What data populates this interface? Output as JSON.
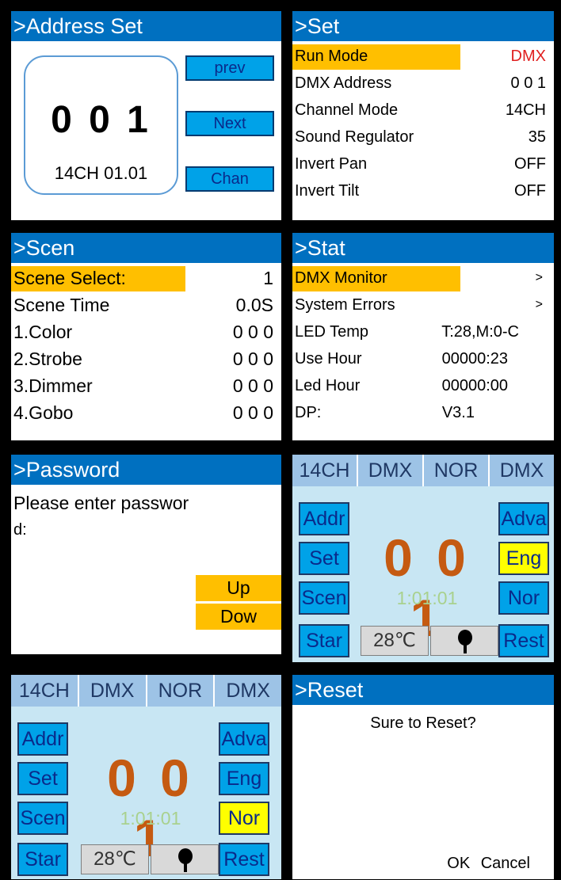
{
  "address_set": {
    "title": ">Address Set",
    "value": "0 0 1",
    "subtitle": "14CH 01.01",
    "buttons": {
      "prev": "prev",
      "next": "Next",
      "chan": "Chan"
    }
  },
  "set": {
    "title": ">Set",
    "rows": [
      {
        "label": "Run Mode",
        "value": "DMX"
      },
      {
        "label": "DMX Address",
        "value": "0 0 1"
      },
      {
        "label": "Channel Mode",
        "value": "14CH"
      },
      {
        "label": "Sound Regulator",
        "value": "35"
      },
      {
        "label": "Invert Pan",
        "value": "OFF"
      },
      {
        "label": "Invert Tilt",
        "value": "OFF"
      }
    ],
    "highlight_color": "#ffbf00",
    "accent_value_color": "#e02020"
  },
  "scen": {
    "title": ">Scen",
    "rows": [
      {
        "label": "Scene Select:",
        "value": "1"
      },
      {
        "label": "Scene Time",
        "value": "0.0S"
      },
      {
        "label": "1.Color",
        "value": "0 0 0"
      },
      {
        "label": "2.Strobe",
        "value": "0 0 0"
      },
      {
        "label": "3.Dimmer",
        "value": "0 0 0"
      },
      {
        "label": "4.Gobo",
        "value": "0 0 0"
      }
    ]
  },
  "stat": {
    "title": ">Stat",
    "rows": [
      {
        "label": "DMX Monitor",
        "value": ">"
      },
      {
        "label": "System Errors",
        "value": ">"
      },
      {
        "label": "LED Temp",
        "value": "T:28,M:0-C"
      },
      {
        "label": "Use Hour",
        "value": "00000:23"
      },
      {
        "label": "Led Hour",
        "value": "00000:00"
      },
      {
        "label": "DP:",
        "value": "V3.1"
      }
    ]
  },
  "password": {
    "title": ">Password",
    "prompt_line1": "Please enter passwor",
    "prompt_line2": "d:",
    "buttons": {
      "up": "Up",
      "down": "Dow"
    }
  },
  "main_eng": {
    "status": [
      "14CH",
      "DMX",
      "NOR",
      "DMX"
    ],
    "left_buttons": [
      "Addr",
      "Set",
      "Scen",
      "Star"
    ],
    "right_buttons": [
      "Adva",
      "Eng",
      "Nor",
      "Rest"
    ],
    "selected": "Eng",
    "address": "0 0 1",
    "time": "1:01:01",
    "temperature": "28℃",
    "icon": "bulb-icon"
  },
  "main_nor": {
    "status": [
      "14CH",
      "DMX",
      "NOR",
      "DMX"
    ],
    "left_buttons": [
      "Addr",
      "Set",
      "Scen",
      "Star"
    ],
    "right_buttons": [
      "Adva",
      "Eng",
      "Nor",
      "Rest"
    ],
    "selected": "Nor",
    "address": "0 0 1",
    "time": "1:01:01",
    "temperature": "28℃",
    "icon": "bulb-icon"
  },
  "reset": {
    "title": ">Reset",
    "question": "Sure to Reset?",
    "ok": "OK",
    "cancel": "Cancel"
  },
  "colors": {
    "title_blue": "#0070c0",
    "button_blue": "#00a2e8",
    "highlight_orange": "#ffbf00",
    "selected_yellow": "#ffff00",
    "address_orange": "#c55a11",
    "time_green": "#a9d18e"
  }
}
